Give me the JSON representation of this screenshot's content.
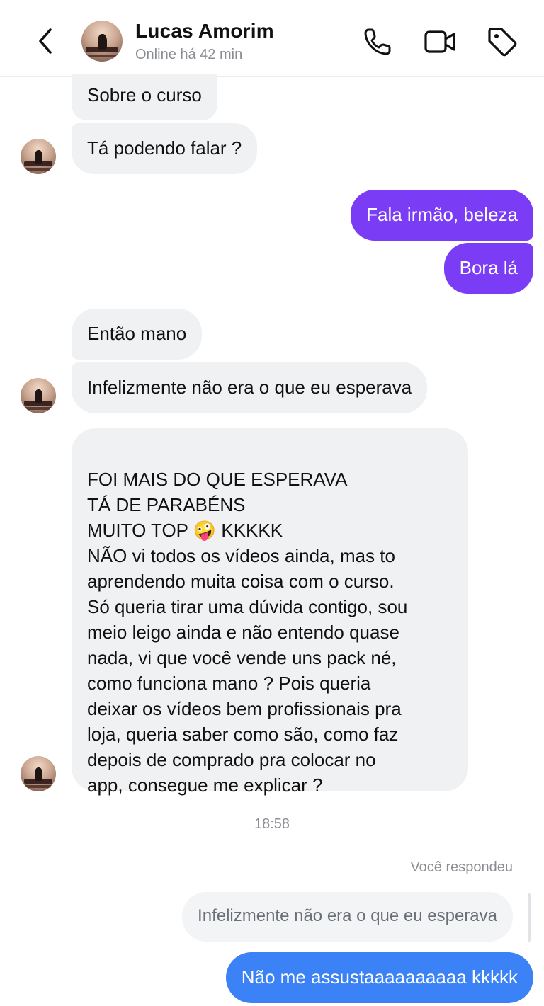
{
  "header": {
    "name": "Lucas Amorim",
    "status": "Online há 42 min",
    "icons": [
      "back-chevron-icon",
      "phone-icon",
      "video-camera-icon",
      "tag-icon"
    ]
  },
  "messages": {
    "m1": "Sobre o curso",
    "m2": "Tá podendo falar ?",
    "m3": "Fala irmão, beleza",
    "m4": "Bora lá",
    "m5": "Então mano",
    "m6": "Infelizmente não era o que eu esperava",
    "m7": "FOI MAIS DO QUE ESPERAVA\nTÁ DE PARABÉNS\nMUITO TOP 🤪 KKKKK\nNÃO vi todos os vídeos ainda, mas to\naprendendo muita coisa com o curso.\nSó queria tirar uma dúvida contigo, sou\nmeio leigo ainda e não entendo quase\nnada, vi que você vende uns pack né,\ncomo funciona mano ? Pois queria\ndeixar os vídeos bem profissionais pra\nloja, queria saber como são, como faz\ndepois de comprado pra colocar no\napp, consegue me explicar ?"
  },
  "timestamp": "18:58",
  "reply": {
    "label": "Você respondeu",
    "quoted": "Infelizmente não era o que eu esperava",
    "text": "Não me assustaaaaaaaaaa kkkkk"
  },
  "colors": {
    "outgoing_purple": "#7a3cf5",
    "outgoing_blue": "#3b82f6",
    "incoming": "#f0f1f3"
  }
}
